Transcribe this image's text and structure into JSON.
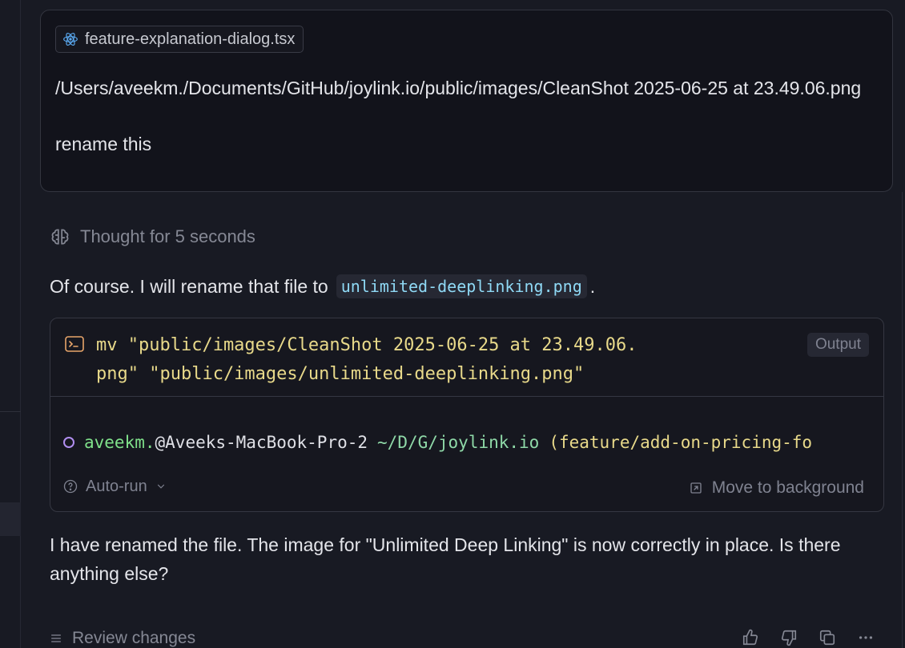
{
  "user_message": {
    "file_pill": {
      "icon": "react-icon",
      "label": "feature-explanation-dialog.tsx"
    },
    "text": "/Users/aveekm./Documents/GitHub/joylink.io/public/images/CleanShot 2025-06-25 at 23.49.06.png\n\nrename this"
  },
  "thought": {
    "icon": "brain-icon",
    "label": "Thought for 5 seconds"
  },
  "assistant_intro": {
    "text": "Of course. I will rename that file to",
    "code": "unlimited-deeplinking.png",
    "suffix": "."
  },
  "terminal": {
    "icon": "terminal-icon",
    "command": "mv \"public/images/CleanShot 2025-06-25 at 23.49.06.\npng\" \"public/images/unlimited-deeplinking.png\"",
    "output_label": "Output",
    "prompt": {
      "user": "aveekm.",
      "host": "@Aveeks-MacBook-Pro-2",
      "path": "~/D/G/joylink.io",
      "branch": "(feature/add-on-pricing-fo"
    },
    "autorun_label": "Auto-run",
    "move_label": "Move to background"
  },
  "assistant_reply": "I have renamed the file. The image for \"Unlimited Deep Linking\" is now correctly in place. Is there anything else?",
  "footer": {
    "review_label": "Review changes"
  },
  "colors": {
    "bg": "#181a23",
    "card": "#12131b",
    "command": "#e8d98a",
    "user": "#7fe08a",
    "code": "#8fd9f5"
  }
}
